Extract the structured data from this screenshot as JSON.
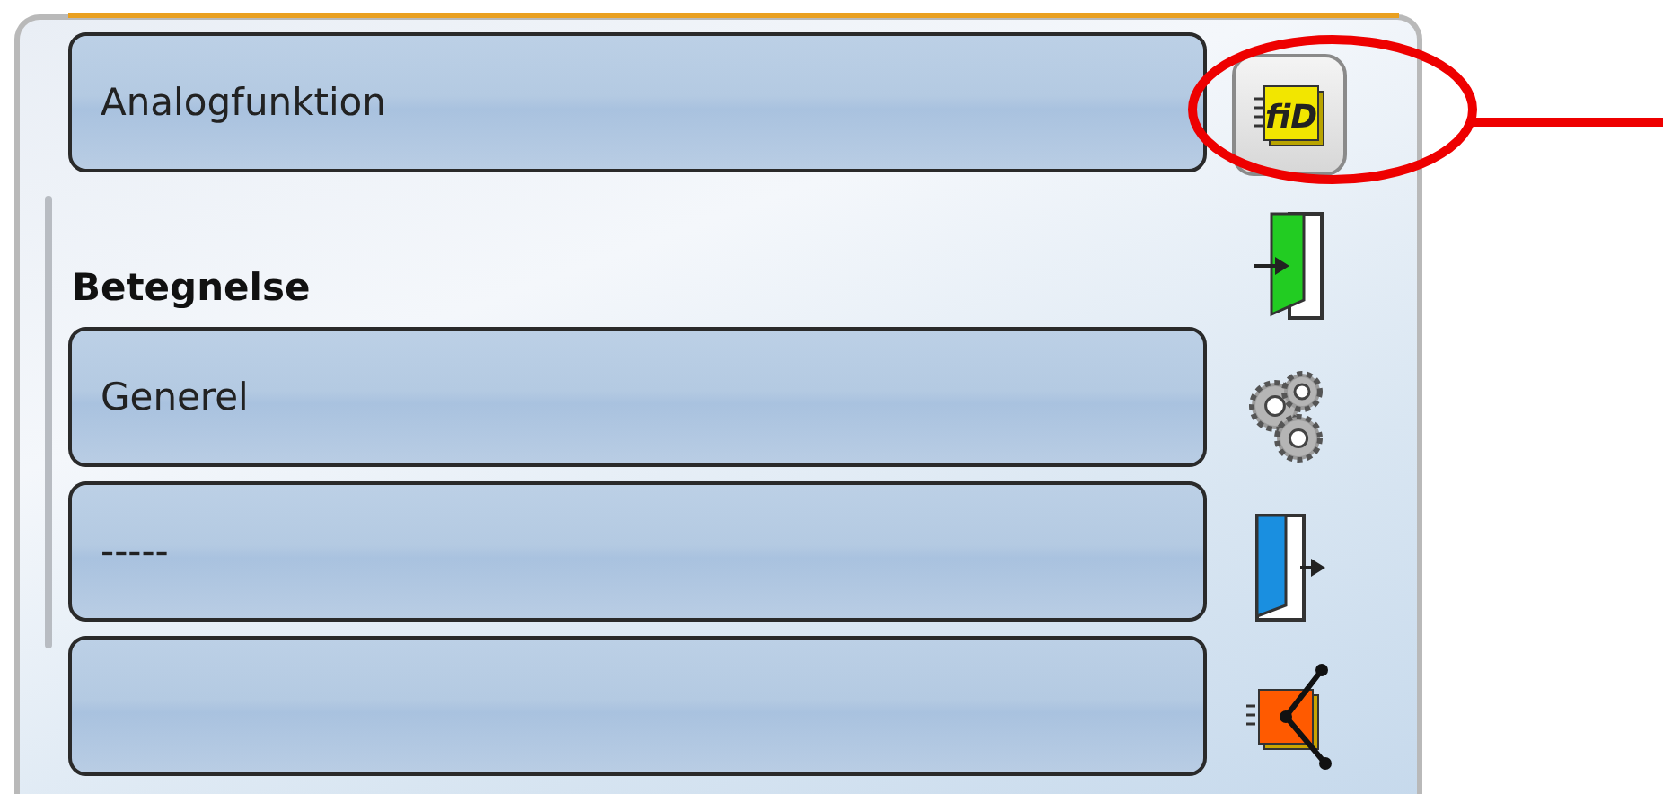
{
  "header_field": {
    "value": "Analogfunktion"
  },
  "section_label": "Betegnelse",
  "fields": [
    {
      "kind": "text",
      "value": "Generel"
    },
    {
      "kind": "text",
      "value": "-----"
    },
    {
      "kind": "blank"
    }
  ],
  "side_icons": [
    {
      "kind": "function-id",
      "label": "fiD",
      "selected": true,
      "circled": true
    },
    {
      "kind": "input",
      "selected": false
    },
    {
      "kind": "settings",
      "selected": false
    },
    {
      "kind": "output",
      "selected": false
    },
    {
      "kind": "diagram",
      "selected": false
    }
  ]
}
